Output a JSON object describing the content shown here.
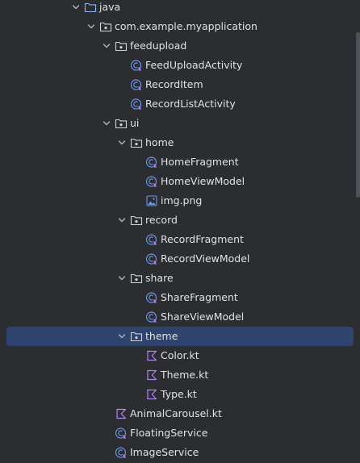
{
  "project_tree": {
    "nodes": [
      {
        "label": "java",
        "icon": "folder-icon",
        "expandable": true,
        "expanded": true,
        "depth": 0
      },
      {
        "label": "com.example.myapplication",
        "icon": "package-icon",
        "expandable": true,
        "expanded": true,
        "depth": 1
      },
      {
        "label": "feedupload",
        "icon": "package-icon",
        "expandable": true,
        "expanded": true,
        "depth": 2
      },
      {
        "label": "FeedUploadActivity",
        "icon": "kotlin-class-icon",
        "expandable": false,
        "depth": 3
      },
      {
        "label": "RecordItem",
        "icon": "kotlin-class-icon",
        "expandable": false,
        "depth": 3
      },
      {
        "label": "RecordListActivity",
        "icon": "kotlin-class-icon",
        "expandable": false,
        "depth": 3
      },
      {
        "label": "ui",
        "icon": "package-icon",
        "expandable": true,
        "expanded": true,
        "depth": 2
      },
      {
        "label": "home",
        "icon": "package-icon",
        "expandable": true,
        "expanded": true,
        "depth": 3
      },
      {
        "label": "HomeFragment",
        "icon": "kotlin-class-icon",
        "expandable": false,
        "depth": 4
      },
      {
        "label": "HomeViewModel",
        "icon": "kotlin-class-icon",
        "expandable": false,
        "depth": 4
      },
      {
        "label": "img.png",
        "icon": "image-file-icon",
        "expandable": false,
        "depth": 4
      },
      {
        "label": "record",
        "icon": "package-icon",
        "expandable": true,
        "expanded": true,
        "depth": 3
      },
      {
        "label": "RecordFragment",
        "icon": "kotlin-class-icon",
        "expandable": false,
        "depth": 4
      },
      {
        "label": "RecordViewModel",
        "icon": "kotlin-class-icon",
        "expandable": false,
        "depth": 4
      },
      {
        "label": "share",
        "icon": "package-icon",
        "expandable": true,
        "expanded": true,
        "depth": 3
      },
      {
        "label": "ShareFragment",
        "icon": "kotlin-class-icon",
        "expandable": false,
        "depth": 4
      },
      {
        "label": "ShareViewModel",
        "icon": "kotlin-class-icon",
        "expandable": false,
        "depth": 4
      },
      {
        "label": "theme",
        "icon": "package-icon",
        "expandable": true,
        "expanded": true,
        "depth": 3,
        "selected": true
      },
      {
        "label": "Color.kt",
        "icon": "kotlin-file-icon",
        "expandable": false,
        "depth": 4
      },
      {
        "label": "Theme.kt",
        "icon": "kotlin-file-icon",
        "expandable": false,
        "depth": 4
      },
      {
        "label": "Type.kt",
        "icon": "kotlin-file-icon",
        "expandable": false,
        "depth": 4
      },
      {
        "label": "AnimalCarousel.kt",
        "icon": "kotlin-file-icon",
        "expandable": false,
        "depth": 2
      },
      {
        "label": "FloatingService",
        "icon": "kotlin-class-icon",
        "expandable": false,
        "depth": 2
      },
      {
        "label": "ImageService",
        "icon": "kotlin-class-icon",
        "expandable": false,
        "depth": 2
      }
    ]
  },
  "colors": {
    "background": "#2b2d30",
    "selection": "#2e436e",
    "text": "#dfe1e5",
    "folder_icon": "#8fb6f9",
    "package_icon": "#cfd1d5",
    "kotlin_class_icon": "#6b95e8",
    "kotlin_file_icon": "#b287f4"
  }
}
